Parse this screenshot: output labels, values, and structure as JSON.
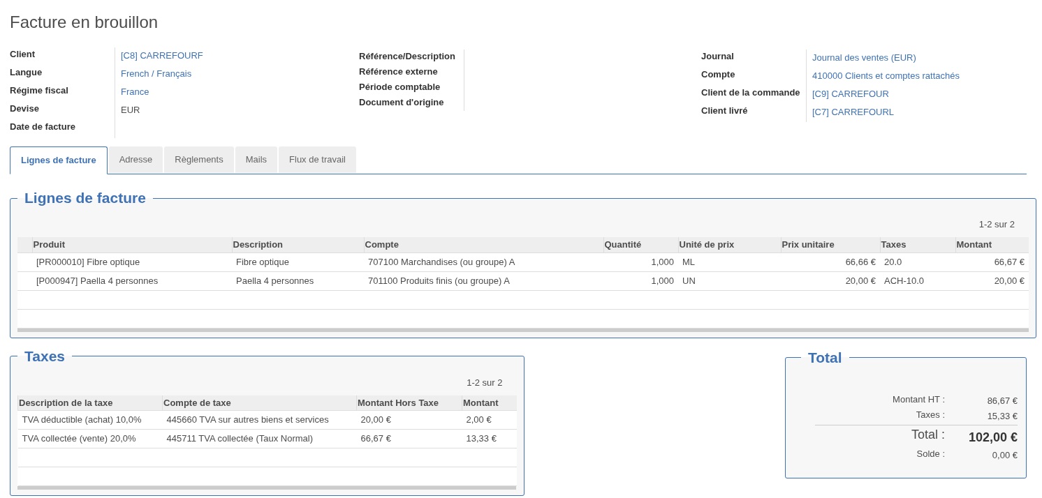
{
  "title": "Facture en brouillon",
  "field_groups": [
    {
      "fields": [
        {
          "label": "Client",
          "value": "[C8] CARREFOURF",
          "kind": "link"
        },
        {
          "label": "Langue",
          "value": "French / Français",
          "kind": "link"
        },
        {
          "label": "Régime fiscal",
          "value": "France",
          "kind": "link"
        },
        {
          "label": "Devise",
          "value": "EUR",
          "kind": "text"
        },
        {
          "label": "Date de facture"
        }
      ]
    },
    {
      "fields": [
        {
          "label": "Référence/Description"
        },
        {
          "label": "Référence externe"
        },
        {
          "label": "Période comptable"
        },
        {
          "label": "Document d'origine"
        }
      ]
    },
    {
      "fields": [
        {
          "label": "Journal",
          "value": "Journal des ventes (EUR)",
          "kind": "link"
        },
        {
          "label": "Compte",
          "value": "410000 Clients et comptes rattachés",
          "kind": "link"
        },
        {
          "label": "Client de la commande",
          "value": "[C9] CARREFOUR",
          "kind": "link"
        },
        {
          "label": "Client livré",
          "value": "[C7] CARREFOURL",
          "kind": "link"
        }
      ]
    }
  ],
  "tabs": [
    {
      "label": "Lignes de facture",
      "selected": true
    },
    {
      "label": "Adresse",
      "selected": false
    },
    {
      "label": "Règlements",
      "selected": false
    },
    {
      "label": "Mails",
      "selected": false
    },
    {
      "label": "Flux de travail",
      "selected": false
    }
  ],
  "invoice_lines": {
    "legend": "Lignes de facture",
    "pager": "1-2 sur 2",
    "columns": [
      "Produit",
      "Description",
      "Compte",
      "Quantité",
      "Unité de prix",
      "Prix unitaire",
      "Taxes",
      "Montant"
    ],
    "rows": [
      [
        "[PR000010] Fibre optique",
        "Fibre optique",
        "707100 Marchandises (ou groupe) A",
        "1,000",
        "ML",
        "66,66 €",
        "20.0",
        "66,67 €"
      ],
      [
        "[P000947] Paella 4 personnes",
        "Paella 4 personnes",
        "701100 Produits finis (ou groupe) A",
        "1,000",
        "UN",
        "20,00 €",
        "ACH-10.0",
        "20,00 €"
      ]
    ]
  },
  "taxes": {
    "legend": "Taxes",
    "pager": "1-2 sur 2",
    "columns": [
      "Description de la taxe",
      "Compte de taxe",
      "Montant Hors Taxe",
      "Montant"
    ],
    "rows": [
      [
        "TVA déductible (achat) 10,0%",
        "445660 TVA sur autres biens et services",
        "20,00 €",
        "2,00 €"
      ],
      [
        "TVA collectée (vente) 20,0%",
        "445711 TVA collectée (Taux Normal)",
        "66,67 €",
        "13,33 €"
      ]
    ]
  },
  "total": {
    "legend": "Total",
    "lines": [
      {
        "label": "Montant HT :",
        "value": "86,67 €",
        "kind": "sub"
      },
      {
        "label": "Taxes :",
        "value": "15,33 €",
        "kind": "sub"
      },
      {
        "label": "Total :",
        "value": "102,00 €",
        "kind": "grand"
      },
      {
        "label": "Solde :",
        "value": "0,00 €",
        "kind": "sub"
      }
    ]
  }
}
